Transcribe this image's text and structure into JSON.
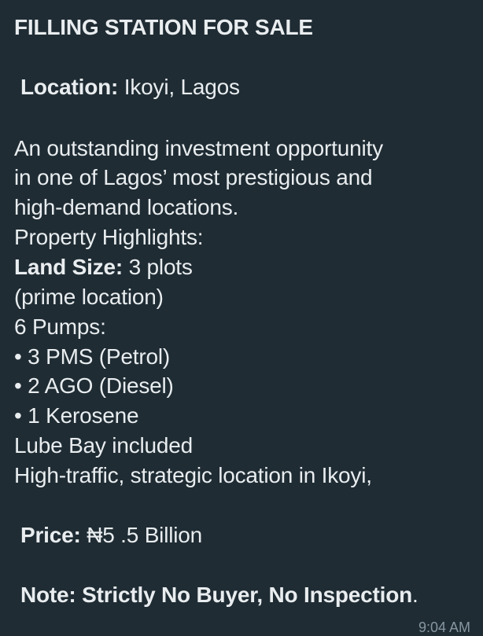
{
  "message": {
    "title": "FILLING STATION FOR SALE",
    "location": {
      "label": "Location:",
      "value": " Ikoyi, Lagos"
    },
    "intro_lines": [
      "An outstanding investment opportunity",
      "in one of Lagos’ most prestigious and",
      "high-demand locations."
    ],
    "highlights_heading": "Property Highlights:",
    "land_size": {
      "label": "Land Size:",
      "value": " 3 plots"
    },
    "land_note": " (prime location)",
    "pumps_heading": "6 Pumps:",
    "pumps": [
      "• 3 PMS (Petrol)",
      "• 2 AGO (Diesel)",
      "• 1 Kerosene"
    ],
    "lube_bay": "Lube Bay included",
    "traffic": "High-traffic, strategic location in Ikoyi,",
    "price": {
      "label": "Price:",
      "value": " ₦5 .5 Billion"
    },
    "note": {
      "text": "Note: Strictly No Buyer, No Inspection",
      "end": "."
    },
    "time": "9:04 AM"
  }
}
